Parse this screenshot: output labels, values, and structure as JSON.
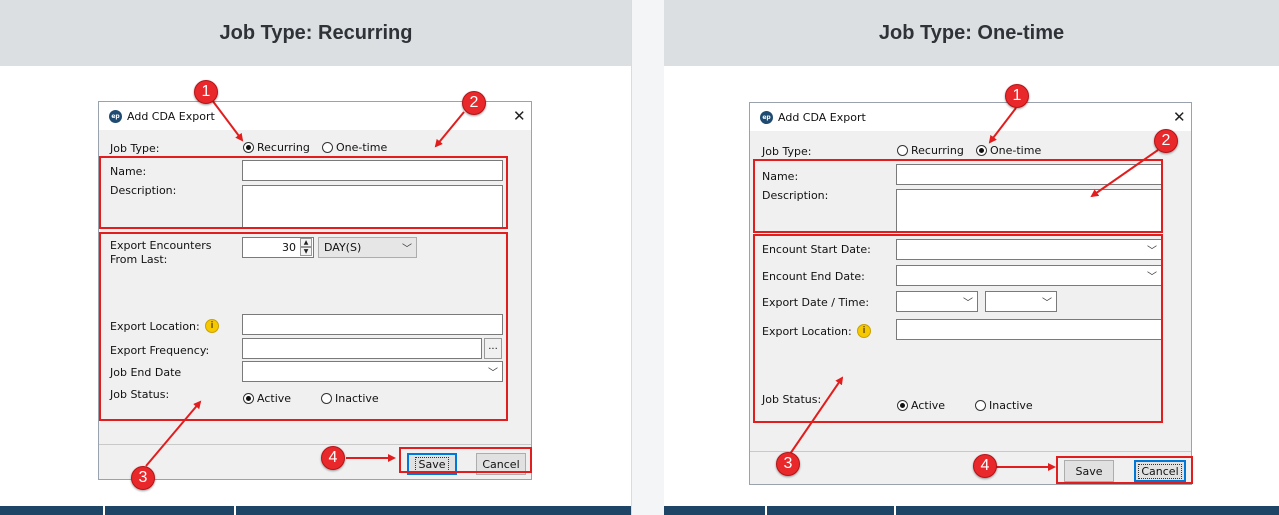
{
  "headers": {
    "left": "Job Type: Recurring",
    "right": "Job Type: One-time"
  },
  "recurring": {
    "title": "Add CDA Export",
    "job_type_label": "Job Type:",
    "radio_recurring": "Recurring",
    "radio_onetime": "One-time",
    "job_type_selected": "Recurring",
    "name_label": "Name:",
    "description_label": "Description:",
    "export_encounters_label_1": "Export Encounters",
    "export_encounters_label_2": "From Last:",
    "spin_value": "30",
    "unit_value": "DAY(S)",
    "export_location_label": "Export Location:",
    "export_frequency_label": "Export Frequency:",
    "job_end_date_label": "Job End Date",
    "job_status_label": "Job Status:",
    "status_active": "Active",
    "status_inactive": "Inactive",
    "job_status_selected": "Active",
    "browse_label": "...",
    "save_label": "Save",
    "cancel_label": "Cancel",
    "close_glyph": "✕"
  },
  "onetime": {
    "title": "Add CDA Export",
    "job_type_label": "Job Type:",
    "radio_recurring": "Recurring",
    "radio_onetime": "One-time",
    "job_type_selected": "One-time",
    "name_label": "Name:",
    "description_label": "Description:",
    "encount_start_label": "Encount Start Date:",
    "encount_end_label": "Encount End Date:",
    "export_datetime_label": "Export Date / Time:",
    "export_location_label": "Export Location:",
    "job_status_label": "Job Status:",
    "status_active": "Active",
    "status_inactive": "Inactive",
    "job_status_selected": "Active",
    "save_label": "Save",
    "cancel_label": "Cancel",
    "close_glyph": "✕"
  },
  "callouts": {
    "one": "1",
    "two": "2",
    "three": "3",
    "four": "4"
  },
  "icons": {
    "app": "app-logo-icon",
    "info": "key-info-icon",
    "chevron": "chevron-down-icon"
  },
  "colors": {
    "annotation_red": "#e21d1d",
    "header_bg": "#dcdfe2",
    "footer_navy": "#1e4466",
    "focus_blue": "#0078d7"
  }
}
